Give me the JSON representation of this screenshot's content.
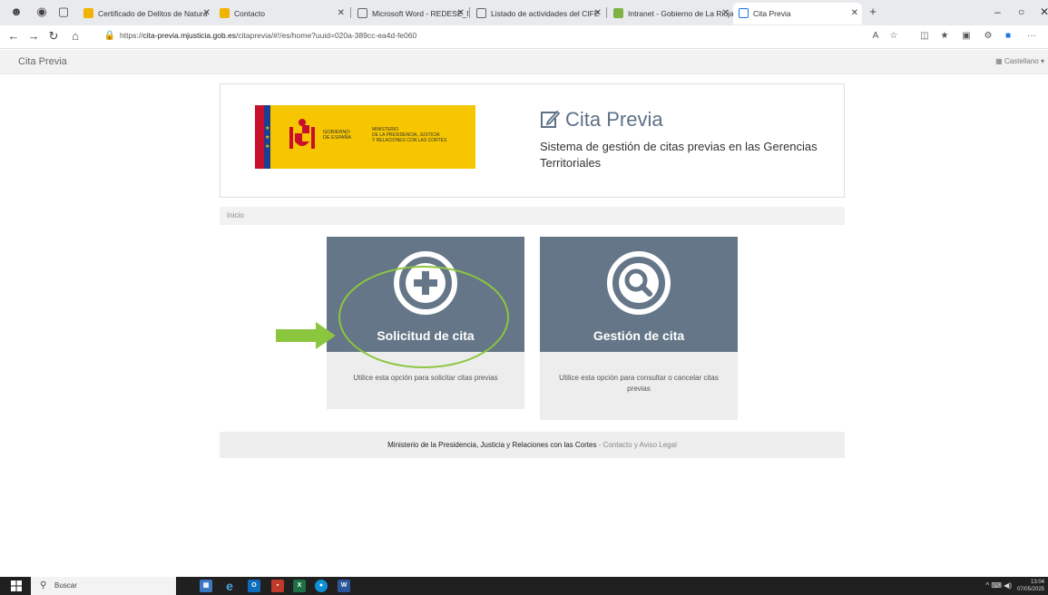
{
  "browser": {
    "tabs": [
      {
        "label": "Certificado de Delitos de Natura",
        "icon": "gov-icon",
        "color": "#f0b400"
      },
      {
        "label": "Contacto",
        "icon": "gov-icon",
        "color": "#f0b400"
      },
      {
        "label": "Microsoft Word - REDESE_Manu",
        "icon": "document-icon",
        "color": "#ffffff"
      },
      {
        "label": "Listado de actividades del CIFE",
        "icon": "document-icon",
        "color": "#ffffff"
      },
      {
        "label": "Intranet - Gobierno de La Rioja",
        "icon": "rioja-icon",
        "color": "#7cb342"
      },
      {
        "label": "Cita Previa",
        "icon": "edit-icon",
        "color": "#ffffff"
      }
    ],
    "url_prefix": "https://",
    "url_domain": "cita-previa.mjusticia.gob.es",
    "url_path": "/citaprevia/#!/es/home?uuid=020a-389cc-ea4d-fe060"
  },
  "app": {
    "brand": "Cita Previa",
    "language": "Castellano"
  },
  "header": {
    "logo_text_1": "GOBIERNO\nDE ESPAÑA",
    "logo_text_2": "MINISTERIO\nDE LA PRESIDENCIA, JUSTICIA\nY RELACIONES CON LAS CORTES",
    "title": "Cita Previa",
    "subtitle": "Sistema de gestión de citas previas en las Gerencias Territoriales"
  },
  "breadcrumb": "Inicio",
  "cards": [
    {
      "title": "Solicitud de cita",
      "icon": "plus-circle-icon",
      "description": "Utilice esta opción para solicitar citas previas"
    },
    {
      "title": "Gestión de cita",
      "icon": "search-circle-icon",
      "description": "Utilice esta opción para consultar o cancelar citas previas"
    }
  ],
  "footer": {
    "text": "Ministerio de la Presidencia, Justicia y Relaciones con las Cortes",
    "separator": " - ",
    "link_contact": "Contacto",
    "link_join": " y ",
    "link_legal": "Aviso Legal"
  },
  "taskbar": {
    "search_placeholder": "Buscar",
    "time": "13:04",
    "date": "07/05/2025"
  },
  "colors": {
    "card_top": "#647687",
    "annotation": "#8cc63f",
    "title": "#5e7187"
  }
}
